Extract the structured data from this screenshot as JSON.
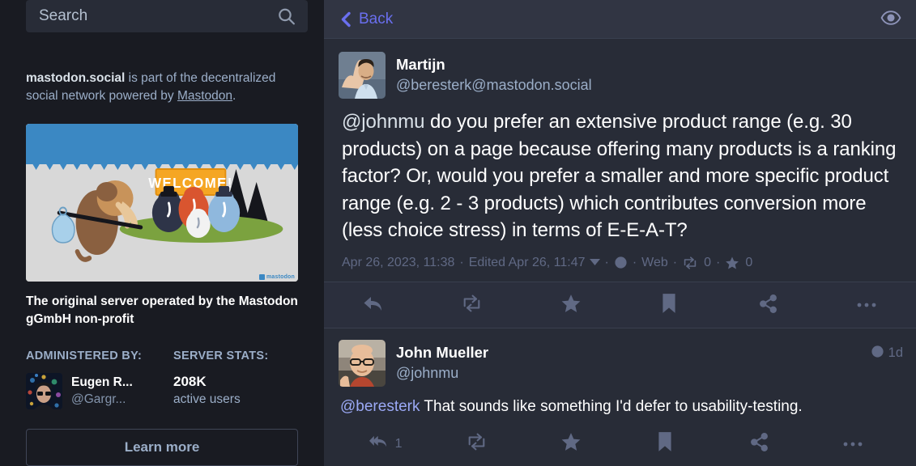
{
  "sidebar": {
    "search": {
      "placeholder": "Search",
      "value": "",
      "icon": "search-icon"
    },
    "blurb": {
      "domain": "mastodon.social",
      "mid": " is part of the decentralized social network powered by ",
      "link": "Mastodon",
      "end": "."
    },
    "hero": {
      "sign_text": "WELCOME!",
      "watermark": "mastodon"
    },
    "description": "The original server operated by the Mastodon gGmbH non-profit",
    "admin_heading": "ADMINISTERED BY:",
    "stats_heading": "SERVER STATS:",
    "admin": {
      "name": "Eugen R...",
      "handle": "@Gargr..."
    },
    "stats": {
      "value": "208K",
      "label": "active users"
    },
    "learn_more_label": "Learn more"
  },
  "header": {
    "back_label": "Back",
    "back_icon": "chevron-left-icon",
    "eye_icon": "eye-icon"
  },
  "detail_status": {
    "display_name": "Martijn",
    "acct": "@beresterk@mastodon.social",
    "content_mention": "@johnmu",
    "content_rest": " do you prefer an extensive product range (e.g. 30 products) on a page because offering many products is a ranking factor? Or, would you prefer a smaller and more specific product range (e.g. 2 - 3 products) which contributes conversion more (less choice stress) in terms of E-E-A-T?",
    "meta": {
      "timestamp": "Apr 26, 2023, 11:38",
      "edited": "Edited Apr 26, 11:47",
      "visibility_icon": "globe-icon",
      "application": "Web",
      "boost_icon": "boost-icon",
      "boost_count": "0",
      "favourite_icon": "star-icon",
      "favourite_count": "0",
      "separator": "·"
    },
    "actions": [
      {
        "name": "reply-button",
        "icon": "reply-icon"
      },
      {
        "name": "boost-button",
        "icon": "boost-icon"
      },
      {
        "name": "favourite-button",
        "icon": "star-icon"
      },
      {
        "name": "bookmark-button",
        "icon": "bookmark-icon"
      },
      {
        "name": "share-button",
        "icon": "share-icon"
      },
      {
        "name": "more-button",
        "icon": "ellipsis-icon"
      }
    ]
  },
  "reply_status": {
    "display_name": "John Mueller",
    "acct": "@johnmu",
    "visibility_icon": "globe-icon",
    "relative_time": "1d",
    "content_mention": "@beresterk",
    "content_rest": " That sounds like something I'd defer to usability-testing.",
    "actions": [
      {
        "name": "reply-all-button",
        "icon": "reply-all-icon",
        "count": "1"
      },
      {
        "name": "boost-button",
        "icon": "boost-icon",
        "count": ""
      },
      {
        "name": "favourite-button",
        "icon": "star-icon",
        "count": ""
      },
      {
        "name": "bookmark-button",
        "icon": "bookmark-icon",
        "count": ""
      },
      {
        "name": "share-button",
        "icon": "share-icon",
        "count": ""
      },
      {
        "name": "more-button",
        "icon": "ellipsis-icon",
        "count": ""
      }
    ]
  },
  "colors": {
    "sidebar_bg": "#191b22",
    "column_bg": "#282c37",
    "accent": "#6a6fef",
    "muted_text": "#9baec8",
    "meta_text": "#606984",
    "hero_sky": "#3b88c3",
    "hero_ground": "#d8d8d8"
  }
}
